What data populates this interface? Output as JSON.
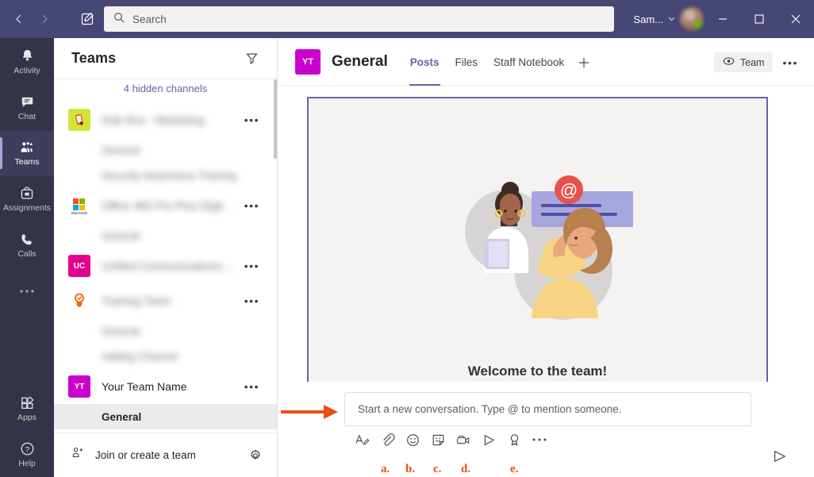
{
  "titlebar": {
    "back_icon": "chevron-left-icon",
    "forward_icon": "chevron-right-icon",
    "compose_icon": "new-chat-icon",
    "search_placeholder": "Search",
    "search_icon": "search-icon",
    "user_name": "Sam...",
    "chevron": "∨",
    "minimize_label": "—",
    "maximize_label": "□",
    "close_label": "✕",
    "bg_color": "#464775"
  },
  "rail": {
    "items": [
      {
        "label": "Activity",
        "icon": "bell-icon",
        "active": false
      },
      {
        "label": "Chat",
        "icon": "chat-icon",
        "active": false
      },
      {
        "label": "Teams",
        "icon": "teams-icon",
        "active": true
      },
      {
        "label": "Assignments",
        "icon": "assignments-icon",
        "active": false
      },
      {
        "label": "Calls",
        "icon": "phone-icon",
        "active": false
      },
      {
        "label": "",
        "icon": "more-horizontal-icon",
        "active": false
      }
    ],
    "bottom": [
      {
        "label": "Apps",
        "icon": "apps-icon"
      },
      {
        "label": "Help",
        "icon": "help-circle-icon"
      }
    ],
    "bg_color": "#33344a",
    "active_color": "#3d3e5c"
  },
  "sidebar": {
    "title": "Teams",
    "filter_icon": "filter-icon",
    "hidden_channels": "4 hidden channels",
    "teams": [
      {
        "name": "Kids Box - Marketing",
        "blurred": true,
        "avatar_type": "image-phone",
        "avatar_initials": "",
        "avatar_color": "#d4e33a",
        "menu_icon": "more-horizontal-icon",
        "channels": [
          {
            "name": "General",
            "blurred": true,
            "selected": false
          },
          {
            "name": "Security Awareness Training",
            "blurred": true,
            "selected": false
          }
        ]
      },
      {
        "name": "Office 365 Pro Plus Digit...",
        "blurred": true,
        "avatar_type": "microsoft",
        "avatar_initials": "",
        "avatar_color": "#ffffff",
        "menu_icon": "more-horizontal-icon",
        "channels": [
          {
            "name": "General",
            "blurred": true,
            "selected": false
          }
        ]
      },
      {
        "name": "Unified Communications ...",
        "blurred": true,
        "avatar_type": "initials",
        "avatar_initials": "UC",
        "avatar_color": "#e3008c",
        "menu_icon": "more-horizontal-icon",
        "channels": []
      },
      {
        "name": "Training Team",
        "blurred": true,
        "avatar_type": "bulb",
        "avatar_initials": "",
        "avatar_color": "#f7630c",
        "menu_icon": "more-horizontal-icon",
        "channels": [
          {
            "name": "General",
            "blurred": true,
            "selected": false
          },
          {
            "name": "Adding Channel",
            "blurred": true,
            "selected": false
          }
        ]
      },
      {
        "name": "Your Team Name",
        "blurred": false,
        "avatar_type": "initials",
        "avatar_initials": "YT",
        "avatar_color": "#cc00cc",
        "menu_icon": "more-horizontal-icon",
        "channels": [
          {
            "name": "General",
            "blurred": false,
            "selected": true
          }
        ]
      }
    ],
    "footer": {
      "join_label": "Join or create a team",
      "join_icon": "person-add-icon",
      "settings_icon": "gear-icon"
    }
  },
  "main": {
    "channel_avatar_initials": "YT",
    "channel_avatar_color": "#cc00cc",
    "channel_title": "General",
    "tabs": [
      {
        "label": "Posts",
        "active": true
      },
      {
        "label": "Files",
        "active": false
      },
      {
        "label": "Staff Notebook",
        "active": false
      }
    ],
    "add_tab_icon": "plus-icon",
    "team_button": {
      "label": "Team",
      "icon": "eye-icon"
    },
    "more_icon": "more-horizontal-icon",
    "welcome": {
      "heading": "Welcome to the team!",
      "illustration": "two-people-mention-illustration",
      "border_color": "#6264a7"
    }
  },
  "composer": {
    "placeholder": "Start a new conversation. Type @ to mention someone.",
    "send_icon": "send-icon",
    "arrow_annotation_color": "#e8500f",
    "tools": [
      {
        "icon": "format-text-icon",
        "letter": ""
      },
      {
        "icon": "attach-paperclip-icon",
        "letter": "a."
      },
      {
        "icon": "emoji-icon",
        "letter": "b."
      },
      {
        "icon": "sticker-icon",
        "letter": "c."
      },
      {
        "icon": "meet-now-video-icon",
        "letter": "d."
      },
      {
        "icon": "stream-icon",
        "letter": ""
      },
      {
        "icon": "praise-icon",
        "letter": "e."
      },
      {
        "icon": "more-horizontal-icon",
        "letter": ""
      }
    ]
  }
}
